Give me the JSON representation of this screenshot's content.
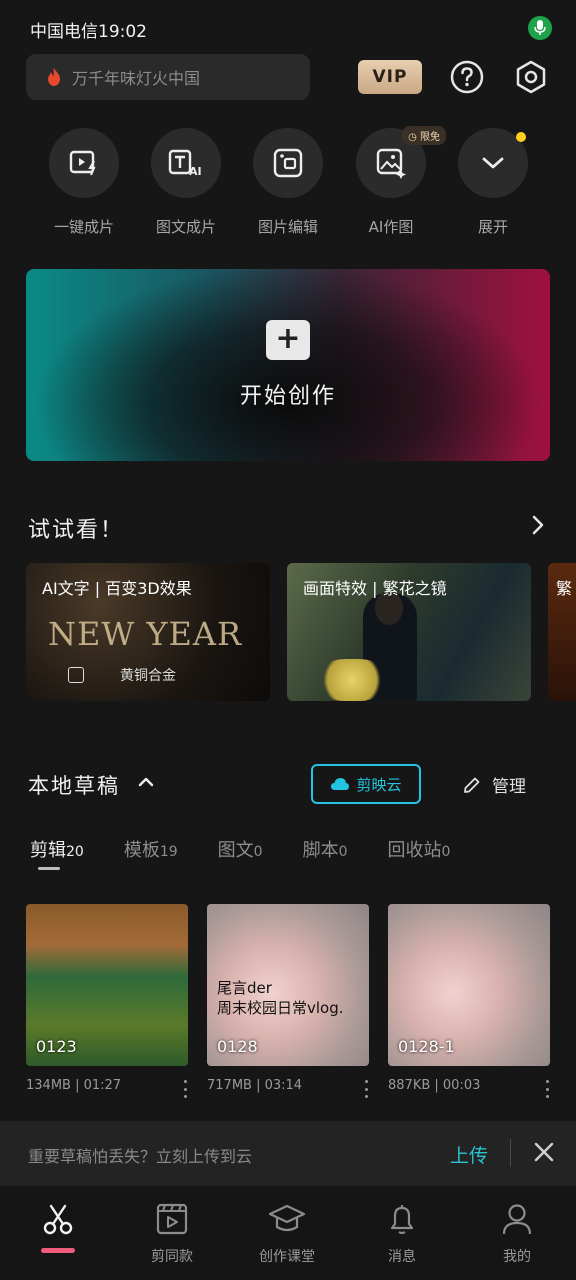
{
  "status_bar": {
    "carrier_time": "中国电信19:02"
  },
  "search": {
    "placeholder": "万千年味灯火中国"
  },
  "header": {
    "vip_label": "VIP"
  },
  "quick_actions": [
    {
      "label": "一键成片",
      "icon": "video-lightning-icon"
    },
    {
      "label": "图文成片",
      "icon": "text-ai-icon"
    },
    {
      "label": "图片编辑",
      "icon": "image-edit-icon"
    },
    {
      "label": "AI作图",
      "icon": "ai-image-icon",
      "badge": "限免"
    },
    {
      "label": "展开",
      "icon": "chevron-down-icon"
    }
  ],
  "create": {
    "plus": "+",
    "label": "开始创作"
  },
  "try_section": {
    "title": "试试看！",
    "cards": [
      {
        "title": "AI文字 | 百变3D效果",
        "art_text": "NEW YEAR",
        "caption": "黄铜合金"
      },
      {
        "title": "画面特效 | 繁花之镜"
      },
      {
        "title": "繁"
      }
    ]
  },
  "drafts": {
    "title": "本地草稿",
    "cloud_label": "剪映云",
    "manage_label": "管理",
    "tabs": [
      {
        "label": "剪辑",
        "count": "20"
      },
      {
        "label": "模板",
        "count": "19"
      },
      {
        "label": "图文",
        "count": "0"
      },
      {
        "label": "脚本",
        "count": "0"
      },
      {
        "label": "回收站",
        "count": "0"
      }
    ],
    "items": [
      {
        "name": "0123",
        "meta": "134MB | 01:27"
      },
      {
        "name": "0128",
        "meta": "717MB | 03:14",
        "caption": "尾言der\n周末校园日常vlog."
      },
      {
        "name": "0128-1",
        "meta": "887KB | 00:03"
      }
    ]
  },
  "upload_banner": {
    "text": "重要草稿怕丢失？立刻上传到云",
    "button": "上传"
  },
  "bottom_nav": [
    {
      "label": "",
      "icon": "scissors-icon"
    },
    {
      "label": "剪同款",
      "icon": "film-play-icon"
    },
    {
      "label": "创作课堂",
      "icon": "graduation-cap-icon"
    },
    {
      "label": "消息",
      "icon": "bell-icon"
    },
    {
      "label": "我的",
      "icon": "user-icon"
    }
  ],
  "colors": {
    "accent_cyan": "#23c4e2",
    "nav_active": "#ee5c7a",
    "badge_dot": "#ffcf1f"
  }
}
